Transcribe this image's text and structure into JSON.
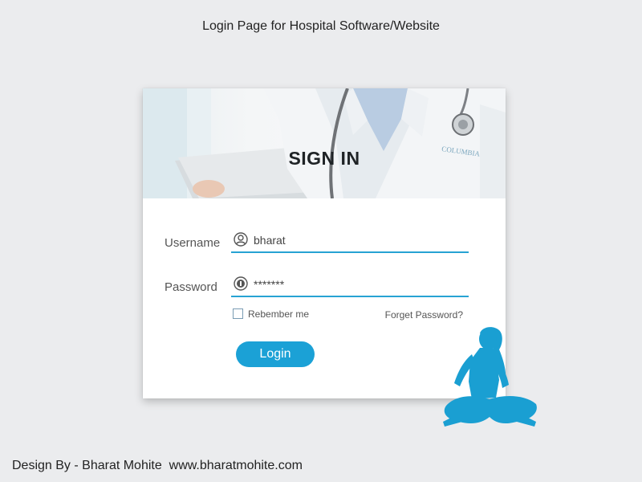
{
  "page": {
    "title": "Login Page for Hospital Software/Website",
    "credit": "Design By - Bharat Mohite  www.bharatmohite.com"
  },
  "hero": {
    "title": "SIGN IN",
    "coat_text": "COLUMBIA"
  },
  "form": {
    "username": {
      "label": "Username",
      "value": "bharat",
      "icon": "user-icon"
    },
    "password": {
      "label": "Password",
      "value": "*******",
      "icon": "key-icon"
    },
    "remember_label": "Rebember me",
    "remember_checked": false,
    "forgot_label": "Forget Password?",
    "login_label": "Login"
  },
  "colors": {
    "accent": "#1ba1d6",
    "underline": "#27a3d3",
    "background": "#ebecee",
    "figure": "#1a9fd2"
  }
}
